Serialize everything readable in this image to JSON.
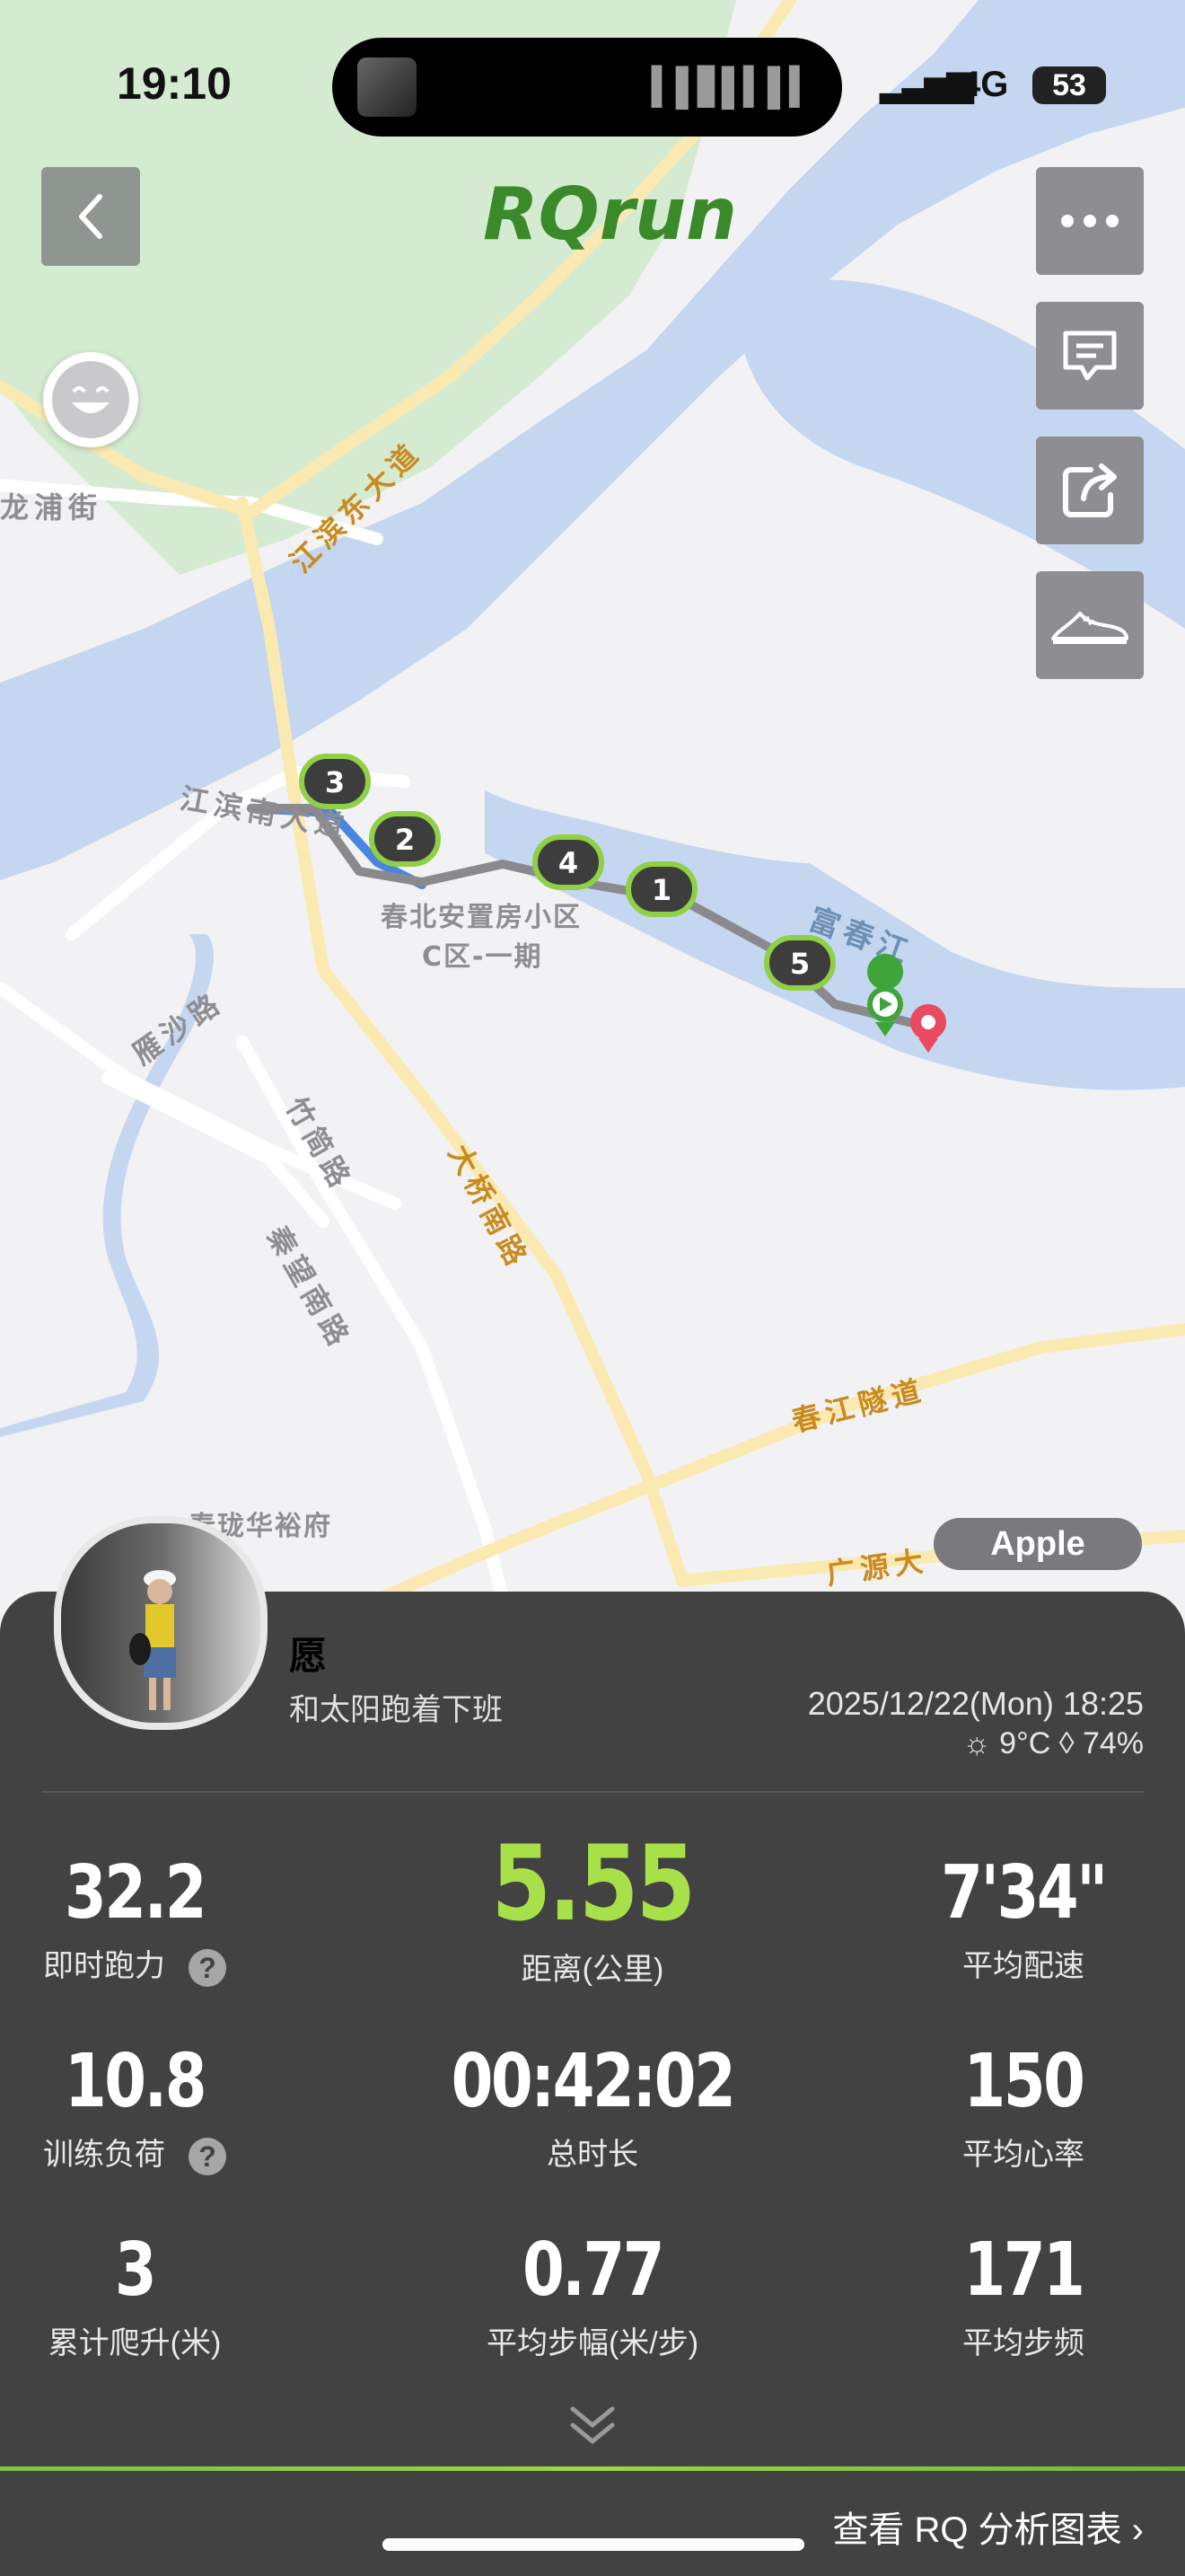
{
  "status_bar": {
    "time": "19:10",
    "network": "4G",
    "battery": "53"
  },
  "map": {
    "brand": "RQrun",
    "labels": {
      "pu_street": "龙浦街",
      "jiangbin_east": "江滨东大道",
      "jiangbin_south": "江滨南大道",
      "community": "春北安置房小区",
      "community2": "C区-一期",
      "fuchun_river": "富春江",
      "yansha_road": "雁沙路",
      "zhujian_road": "竹简路",
      "qinwang_road": "秦望南路",
      "daqiao_road": "大桥南路",
      "chunjiang_tunnel": "春江隧道",
      "guangyuan": "广源大",
      "chunlong": "春珑华裕府"
    },
    "km_markers": [
      "1",
      "2",
      "3",
      "4",
      "5"
    ],
    "map_source": "Apple"
  },
  "profile": {
    "name": "愿",
    "motto": "和太阳跑着下班",
    "datetime": "2025/12/22(Mon) 18:25",
    "weather": "☼ 9°C  ◊ 74%"
  },
  "stats": {
    "running_power": {
      "value": "32.2",
      "label": "即时跑力"
    },
    "distance": {
      "value": "5.55",
      "label": "距离(公里)"
    },
    "avg_pace": {
      "value": "7'34\"",
      "label": "平均配速"
    },
    "training_load": {
      "value": "10.8",
      "label": "训练负荷"
    },
    "total_time": {
      "value": "00:42:02",
      "label": "总时长"
    },
    "avg_hr": {
      "value": "150",
      "label": "平均心率"
    },
    "elevation": {
      "value": "3",
      "label": "累计爬升(米)"
    },
    "stride": {
      "value": "0.77",
      "label": "平均步幅(米/步)"
    },
    "cadence": {
      "value": "171",
      "label": "平均步频"
    }
  },
  "help_mark": "?",
  "footer": {
    "link": "查看 RQ 分析图表 ›"
  },
  "colors": {
    "accent": "#a8e04a",
    "panel": "#424242",
    "river": "#c5d7f0",
    "forest": "#d4ebd2"
  }
}
